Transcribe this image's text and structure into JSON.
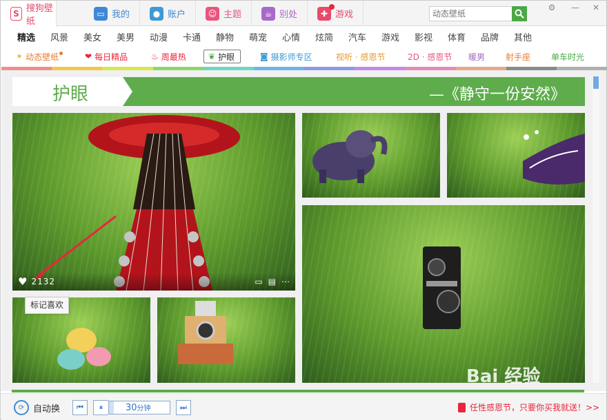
{
  "tabs": [
    {
      "label": "搜狗壁纸",
      "icon": "sogou-logo-icon",
      "color": "#e84a6a",
      "active": true
    },
    {
      "label": "我的",
      "icon": "monitor-icon",
      "color": "#3e88d6"
    },
    {
      "label": "账户",
      "icon": "user-icon",
      "color": "#3e9ad6"
    },
    {
      "label": "主题",
      "icon": "theme-icon",
      "color": "#e8557d"
    },
    {
      "label": "别处",
      "icon": "coffee-icon",
      "color": "#a868c9"
    },
    {
      "label": "游戏",
      "icon": "gamepad-icon",
      "color": "#e84a6a"
    }
  ],
  "search": {
    "placeholder": "动态壁纸"
  },
  "categories": [
    "精选",
    "风景",
    "美女",
    "美男",
    "动漫",
    "卡通",
    "静物",
    "萌宠",
    "心情",
    "炫简",
    "汽车",
    "游戏",
    "影视",
    "体育",
    "品牌",
    "其他"
  ],
  "featured": [
    {
      "label": "动态壁纸",
      "icon": "magic-wand-icon",
      "color": "#e87a2e"
    },
    {
      "label": "每日精品",
      "icon": "heart-icon",
      "color": "#e8263c"
    },
    {
      "label": "周最热",
      "icon": "flame-icon",
      "color": "#e8263c"
    },
    {
      "label": "护眼",
      "icon": "leaf-icon",
      "color": "#4aa845"
    },
    {
      "label": "摄影师专区",
      "icon": "camera-icon",
      "color": "#3e9ad6"
    },
    {
      "label": "视听 · 感恩节",
      "color": "#e89a2e"
    },
    {
      "label": "2D · 感恩节",
      "color": "#e8557d"
    },
    {
      "label": "暖男",
      "color": "#a868c9"
    },
    {
      "label": "射手座",
      "color": "#e87a2e"
    },
    {
      "label": "单车时光",
      "color": "#4aa845"
    }
  ],
  "colorbar": [
    "#f28c8c",
    "#f2c84b",
    "#d8e84b",
    "#8bd86a",
    "#6ad8c4",
    "#6ab8e8",
    "#8a9ae8",
    "#c48ae8",
    "#e88ab8",
    "#e8a88a",
    "#8a8a8a",
    "#b0b0b0"
  ],
  "banner": {
    "title": "护眼",
    "slogan": "—《静守一份安然》"
  },
  "main_tile": {
    "likes": "2132"
  },
  "tooltip": "标记喜欢",
  "footer": {
    "auto_switch": "自动换",
    "timer_value": "30",
    "timer_unit": "分钟",
    "promo": "任性感恩节，只要你买我就送！>>"
  },
  "watermark": "Bai 经验"
}
